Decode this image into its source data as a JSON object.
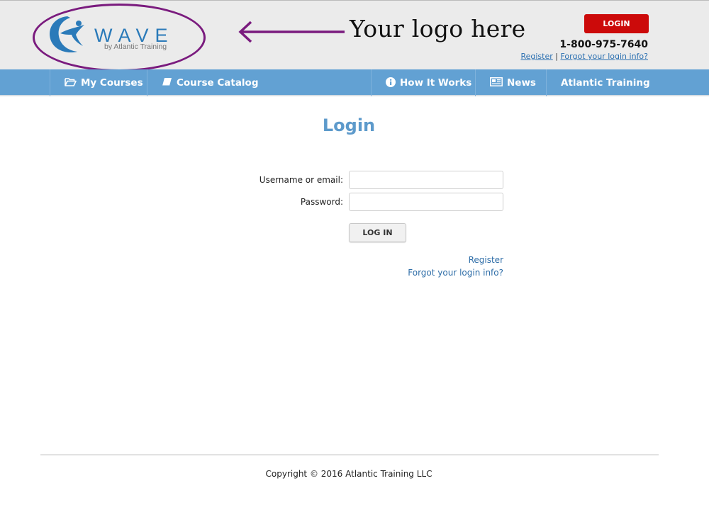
{
  "header": {
    "logo": {
      "name": "WAVE",
      "tagline": "by Atlantic Training",
      "icon": "swimmer-wave-icon"
    },
    "annotation": {
      "text": "Your logo here",
      "icon": "arrow-left-icon",
      "color": "#7a1b7e"
    },
    "login_button": "LOGIN",
    "phone": "1-800-975-7640",
    "register_link": "Register",
    "separator": "|",
    "forgot_link": "Forgot your login info?"
  },
  "nav": {
    "items": [
      {
        "label": "My Courses",
        "icon": "folder-open-icon"
      },
      {
        "label": "Course Catalog",
        "icon": "book-icon"
      },
      {
        "label": "How It Works",
        "icon": "info-circle-icon"
      },
      {
        "label": "News",
        "icon": "newspaper-icon"
      },
      {
        "label": "Atlantic Training",
        "icon": ""
      }
    ]
  },
  "login_form": {
    "title": "Login",
    "username_label": "Username or email:",
    "username_value": "",
    "password_label": "Password:",
    "password_value": "",
    "submit_label": "LOG IN",
    "register_link": "Register",
    "forgot_link": "Forgot your login info?"
  },
  "footer": {
    "copyright": "Copyright © 2016 Atlantic Training LLC"
  },
  "colors": {
    "brand_blue": "#2a7ab9",
    "nav_blue": "#62a1d3",
    "login_red": "#cc0a0a",
    "title_blue": "#5d9acb"
  }
}
